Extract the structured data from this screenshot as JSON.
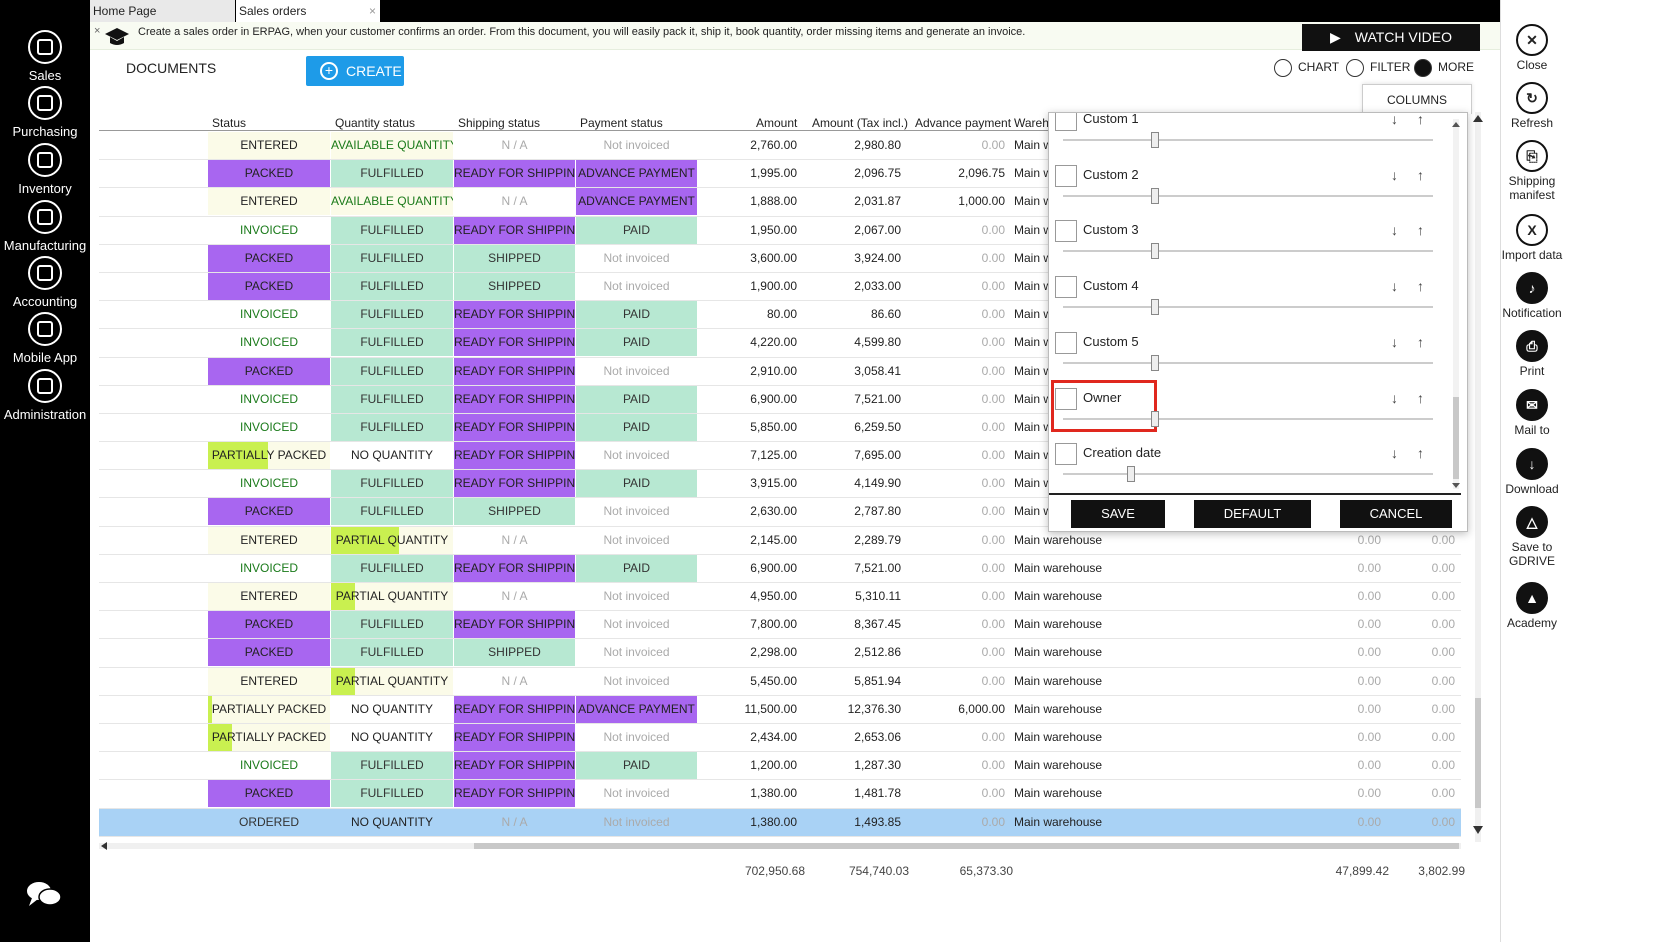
{
  "left_nav": [
    {
      "label": "Sales",
      "icon": "sales-icon"
    },
    {
      "label": "Purchasing",
      "icon": "purchasing-icon"
    },
    {
      "label": "Inventory",
      "icon": "inventory-icon"
    },
    {
      "label": "Manufacturing",
      "icon": "manufacturing-icon"
    },
    {
      "label": "Accounting",
      "icon": "accounting-icon"
    },
    {
      "label": "Mobile App",
      "icon": "mobile-app-icon"
    },
    {
      "label": "Administration",
      "icon": "administration-icon"
    }
  ],
  "tabs": [
    {
      "label": "Home Page"
    },
    {
      "label": "Sales orders",
      "close": "x"
    }
  ],
  "banner": {
    "text": "Create a sales order in ERPAG, when your customer confirms an order. From this document, you will easily pack it, ship it, book quantity, order missing items and generate an invoice.",
    "watch_video": "WATCH VIDEO"
  },
  "toolbar": {
    "documents": "DOCUMENTS",
    "create": "CREATE",
    "chart": "CHART",
    "filter": "FILTER",
    "more": "MORE",
    "columns": "COLUMNS"
  },
  "headers": {
    "status": "Status",
    "quantity": "Quantity status",
    "shipping": "Shipping status",
    "payment": "Payment status",
    "amount": "Amount",
    "amount_tax": "Amount (Tax incl.)",
    "advance": "Advance payment",
    "warehouse": "Wareho"
  },
  "rows": [
    {
      "status": "ENTERED",
      "qty": "AVAILABLE QUANTITY",
      "ship": "N / A",
      "pay": "Not invoiced",
      "amount": "2,760.00",
      "tax": "2,980.80",
      "adv": "0.00",
      "wh": "Main w"
    },
    {
      "status": "PACKED",
      "qty": "FULFILLED",
      "ship": "READY FOR SHIPPING",
      "pay": "ADVANCE PAYMENT",
      "amount": "1,995.00",
      "tax": "2,096.75",
      "adv": "2,096.75",
      "wh": "Main w"
    },
    {
      "status": "ENTERED",
      "qty": "AVAILABLE QUANTITY",
      "ship": "N / A",
      "pay": "ADVANCE PAYMENT",
      "amount": "1,888.00",
      "tax": "2,031.87",
      "adv": "1,000.00",
      "wh": "Main w"
    },
    {
      "status": "INVOICED",
      "qty": "FULFILLED",
      "ship": "READY FOR SHIPPING",
      "pay": "PAID",
      "amount": "1,950.00",
      "tax": "2,067.00",
      "adv": "0.00",
      "wh": "Main w"
    },
    {
      "status": "PACKED",
      "qty": "FULFILLED",
      "ship": "SHIPPED",
      "pay": "Not invoiced",
      "amount": "3,600.00",
      "tax": "3,924.00",
      "adv": "0.00",
      "wh": "Main w"
    },
    {
      "status": "PACKED",
      "qty": "FULFILLED",
      "ship": "SHIPPED",
      "pay": "Not invoiced",
      "amount": "1,900.00",
      "tax": "2,033.00",
      "adv": "0.00",
      "wh": "Main w"
    },
    {
      "status": "INVOICED",
      "qty": "FULFILLED",
      "ship": "READY FOR SHIPPING",
      "pay": "PAID",
      "amount": "80.00",
      "tax": "86.60",
      "adv": "0.00",
      "wh": "Main w"
    },
    {
      "status": "INVOICED",
      "qty": "FULFILLED",
      "ship": "READY FOR SHIPPING",
      "pay": "PAID",
      "amount": "4,220.00",
      "tax": "4,599.80",
      "adv": "0.00",
      "wh": "Main w"
    },
    {
      "status": "PACKED",
      "qty": "FULFILLED",
      "ship": "READY FOR SHIPPING",
      "pay": "Not invoiced",
      "amount": "2,910.00",
      "tax": "3,058.41",
      "adv": "0.00",
      "wh": "Main w"
    },
    {
      "status": "INVOICED",
      "qty": "FULFILLED",
      "ship": "READY FOR SHIPPING",
      "pay": "PAID",
      "amount": "6,900.00",
      "tax": "7,521.00",
      "adv": "0.00",
      "wh": "Main w"
    },
    {
      "status": "INVOICED",
      "qty": "FULFILLED",
      "ship": "READY FOR SHIPPING",
      "pay": "PAID",
      "amount": "5,850.00",
      "tax": "6,259.50",
      "adv": "0.00",
      "wh": "Main w"
    },
    {
      "status": "PARTIALLY PACKED",
      "qty": "NO QUANTITY",
      "ship": "READY FOR SHIPPING",
      "pay": "Not invoiced",
      "amount": "7,125.00",
      "tax": "7,695.00",
      "adv": "0.00",
      "wh": "Main w"
    },
    {
      "status": "INVOICED",
      "qty": "FULFILLED",
      "ship": "READY FOR SHIPPING",
      "pay": "PAID",
      "amount": "3,915.00",
      "tax": "4,149.90",
      "adv": "0.00",
      "wh": "Main w"
    },
    {
      "status": "PACKED",
      "qty": "FULFILLED",
      "ship": "SHIPPED",
      "pay": "Not invoiced",
      "amount": "2,630.00",
      "tax": "2,787.80",
      "adv": "0.00",
      "wh": "Main w"
    },
    {
      "status": "ENTERED",
      "qty": "PARTIAL QUANTITY",
      "ship": "N / A",
      "pay": "Not invoiced",
      "amount": "2,145.00",
      "tax": "2,289.79",
      "adv": "0.00",
      "wh": "Main warehouse",
      "c1": "0.00",
      "c2": "0.00"
    },
    {
      "status": "INVOICED",
      "qty": "FULFILLED",
      "ship": "READY FOR SHIPPING",
      "pay": "PAID",
      "amount": "6,900.00",
      "tax": "7,521.00",
      "adv": "0.00",
      "wh": "Main warehouse",
      "c1": "0.00",
      "c2": "0.00"
    },
    {
      "status": "ENTERED",
      "qty": "PARTIAL QUANTITY",
      "ship": "N / A",
      "pay": "Not invoiced",
      "amount": "4,950.00",
      "tax": "5,310.11",
      "adv": "0.00",
      "wh": "Main warehouse",
      "c1": "0.00",
      "c2": "0.00"
    },
    {
      "status": "PACKED",
      "qty": "FULFILLED",
      "ship": "READY FOR SHIPPING",
      "pay": "Not invoiced",
      "amount": "7,800.00",
      "tax": "8,367.45",
      "adv": "0.00",
      "wh": "Main warehouse",
      "c1": "0.00",
      "c2": "0.00"
    },
    {
      "status": "PACKED",
      "qty": "FULFILLED",
      "ship": "SHIPPED",
      "pay": "Not invoiced",
      "amount": "2,298.00",
      "tax": "2,512.86",
      "adv": "0.00",
      "wh": "Main warehouse",
      "c1": "0.00",
      "c2": "0.00"
    },
    {
      "status": "ENTERED",
      "qty": "PARTIAL QUANTITY",
      "ship": "N / A",
      "pay": "Not invoiced",
      "amount": "5,450.00",
      "tax": "5,851.94",
      "adv": "0.00",
      "wh": "Main warehouse",
      "c1": "0.00",
      "c2": "0.00"
    },
    {
      "status": "PARTIALLY PACKED",
      "qty": "NO QUANTITY",
      "ship": "READY FOR SHIPPING",
      "pay": "ADVANCE PAYMENT",
      "amount": "11,500.00",
      "tax": "12,376.30",
      "adv": "6,000.00",
      "wh": "Main warehouse",
      "c1": "0.00",
      "c2": "0.00"
    },
    {
      "status": "PARTIALLY PACKED",
      "qty": "NO QUANTITY",
      "ship": "READY FOR SHIPPING",
      "pay": "Not invoiced",
      "amount": "2,434.00",
      "tax": "2,653.06",
      "adv": "0.00",
      "wh": "Main warehouse",
      "c1": "0.00",
      "c2": "0.00"
    },
    {
      "status": "INVOICED",
      "qty": "FULFILLED",
      "ship": "READY FOR SHIPPING",
      "pay": "PAID",
      "amount": "1,200.00",
      "tax": "1,287.30",
      "adv": "0.00",
      "wh": "Main warehouse",
      "c1": "0.00",
      "c2": "0.00"
    },
    {
      "status": "PACKED",
      "qty": "FULFILLED",
      "ship": "READY FOR SHIPPING",
      "pay": "Not invoiced",
      "amount": "1,380.00",
      "tax": "1,481.78",
      "adv": "0.00",
      "wh": "Main warehouse",
      "c1": "0.00",
      "c2": "0.00"
    },
    {
      "status": "ORDERED",
      "qty": "NO QUANTITY",
      "ship": "N / A",
      "pay": "Not invoiced",
      "amount": "1,380.00",
      "tax": "1,493.85",
      "adv": "0.00",
      "wh": "Main warehouse",
      "c1": "0.00",
      "c2": "0.00",
      "selected": true
    }
  ],
  "totals": {
    "amount": "702,950.68",
    "tax": "754,740.03",
    "adv": "65,373.30",
    "c1": "47,899.42",
    "c2": "3,802.99"
  },
  "columns_popup": {
    "items": [
      {
        "label": "Custom 1",
        "checked": false
      },
      {
        "label": "Custom 2",
        "checked": false
      },
      {
        "label": "Custom 3",
        "checked": false
      },
      {
        "label": "Custom 4",
        "checked": false
      },
      {
        "label": "Custom 5",
        "checked": false
      },
      {
        "label": "Owner",
        "checked": false,
        "highlighted": true
      },
      {
        "label": "Creation date",
        "checked": false
      }
    ],
    "save": "SAVE",
    "default": "DEFAULT",
    "cancel": "CANCEL"
  },
  "right_nav": [
    {
      "label": "Close",
      "icon": "close-icon"
    },
    {
      "label": "Refresh",
      "icon": "refresh-icon"
    },
    {
      "label": "Shipping manifest",
      "icon": "shipping-manifest-icon"
    },
    {
      "label": "Import data",
      "icon": "import-data-icon"
    },
    {
      "label": "Notification",
      "icon": "bell-icon"
    },
    {
      "label": "Print",
      "icon": "print-icon"
    },
    {
      "label": "Mail to",
      "icon": "mail-icon"
    },
    {
      "label": "Download",
      "icon": "download-icon"
    },
    {
      "label": "Save to GDRIVE",
      "icon": "gdrive-icon"
    },
    {
      "label": "Academy",
      "icon": "academy-icon"
    }
  ],
  "colors": {
    "packed": "#a866f0",
    "fulfilled": "#b7e8d2",
    "partial_bar": "#c9f050",
    "selected_row": "#a9d2f5",
    "create_button": "#1e9be8",
    "highlight": "#e0281e"
  }
}
